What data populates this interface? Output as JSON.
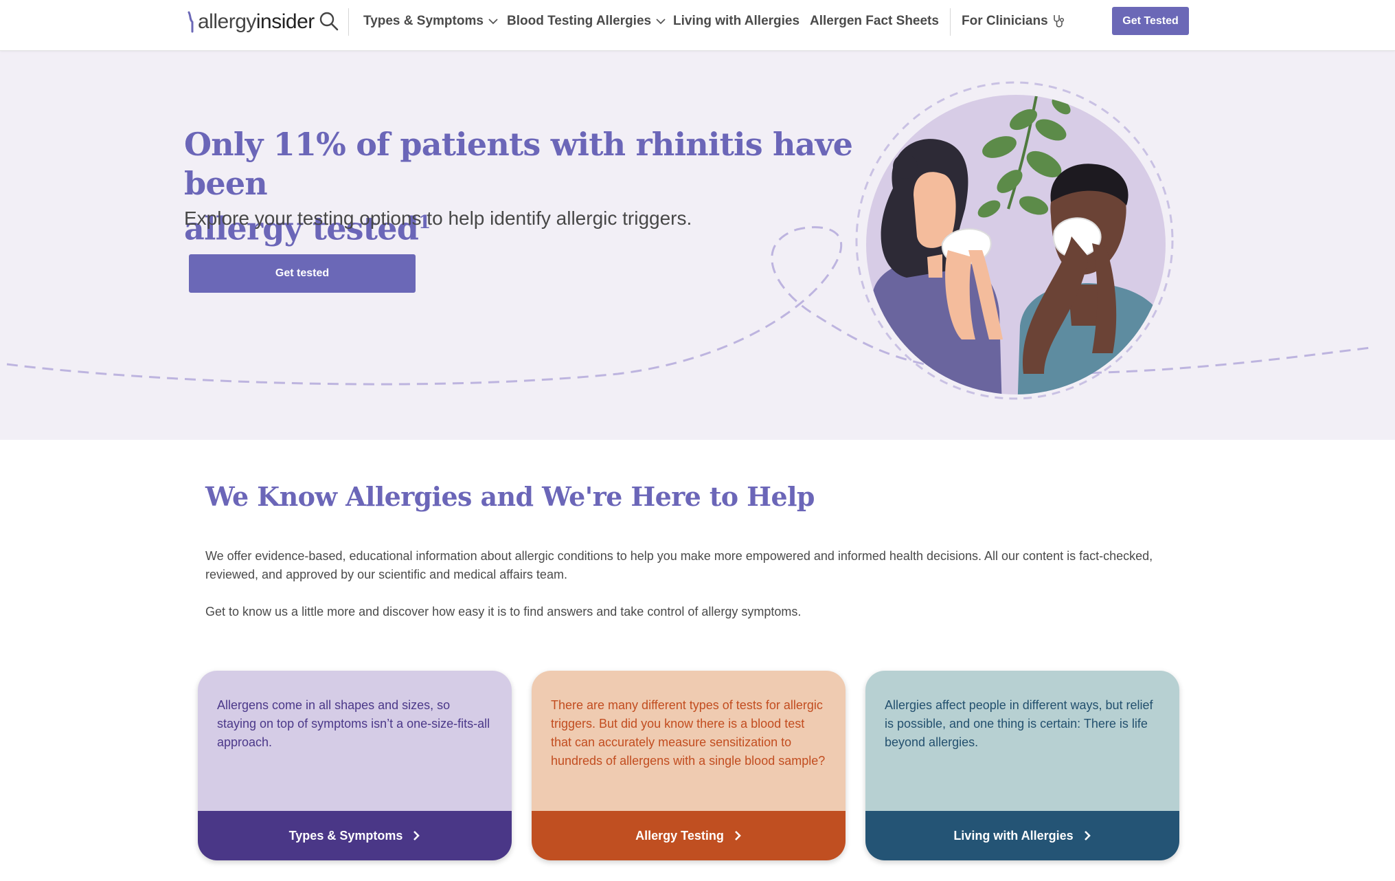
{
  "header": {
    "logo_light": "allergy",
    "logo_bold": "insider",
    "nav": [
      {
        "label": "Types & Symptoms",
        "has_dropdown": true
      },
      {
        "label": "Blood Testing Allergies",
        "has_dropdown": true
      },
      {
        "label": "Living with Allergies",
        "has_dropdown": false
      },
      {
        "label": "Allergen Fact Sheets",
        "has_dropdown": false
      },
      {
        "label": "For Clinicians",
        "icon": "stethoscope-icon"
      }
    ],
    "cta": "Get Tested"
  },
  "hero": {
    "title_line1": "Only 11% of patients with rhinitis have been",
    "title_line2": "allergy tested",
    "title_sup": "1",
    "subtitle": "Explore your testing options to help identify allergic triggers.",
    "cta": "Get tested"
  },
  "intro": {
    "title": "We Know Allergies and We're Here to Help",
    "paragraph1": "We offer evidence-based, educational information about allergic conditions to help you make more empowered and informed health decisions. All our content is fact-checked, reviewed, and approved by our scientific and medical affairs team.",
    "paragraph2": "Get to know us a little more and discover how easy it is to find answers and take control of allergy symptoms."
  },
  "cards": [
    {
      "text": "Allergens come in all shapes and sizes, so staying on top of symptoms isn’t a one-size-fits-all approach.",
      "link": "Types & Symptoms"
    },
    {
      "text": "There are many different types of tests for allergic triggers. But did you know there is a blood test that can accurately measure sensitization to hundreds of allergens with a single blood sample?",
      "link": "Allergy Testing"
    },
    {
      "text": "Allergies affect people in different ways, but relief is possible, and one thing is certain: There is life beyond allergies.",
      "link": "Living with Allergies"
    }
  ],
  "colors": {
    "brand_purple": "#6b68b7",
    "hero_bg": "#f2eff6",
    "card1": "#4a3787",
    "card2": "#c04f21",
    "card3": "#245475"
  }
}
